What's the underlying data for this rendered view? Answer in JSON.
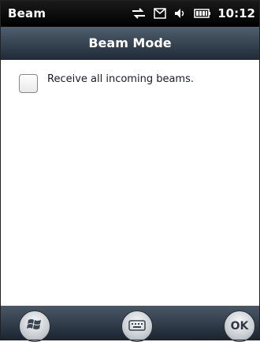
{
  "status_bar": {
    "app_title": "Beam",
    "time": "10:12"
  },
  "header": {
    "title": "Beam Mode"
  },
  "content": {
    "receive_checkbox": {
      "label": "Receive all incoming beams.",
      "checked": false
    }
  },
  "softkeys": {
    "ok_label": "OK",
    "start_icon": "windows-flag-icon",
    "keyboard_icon": "keyboard-icon"
  }
}
